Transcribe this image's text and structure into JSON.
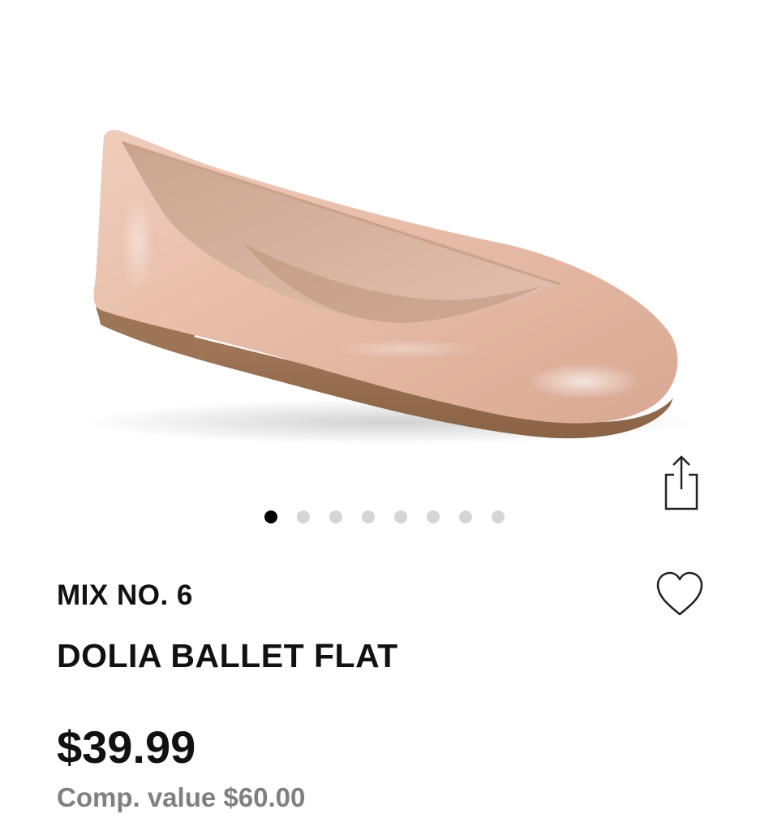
{
  "carousel": {
    "image_alt": "Blush patent ballet flat",
    "dot_count": 8,
    "active_index": 0
  },
  "product": {
    "brand": "MIX NO. 6",
    "name": "DOLIA BALLET FLAT",
    "price": "$39.99",
    "comp_value": "Comp. value $60.00"
  },
  "icons": {
    "share": "share-icon",
    "favorite": "heart-icon"
  },
  "colors": {
    "active_dot": "#000000",
    "inactive_dot": "#d5d5d5",
    "comp_value_text": "#808080",
    "shoe_body": "#e8c1ae"
  }
}
